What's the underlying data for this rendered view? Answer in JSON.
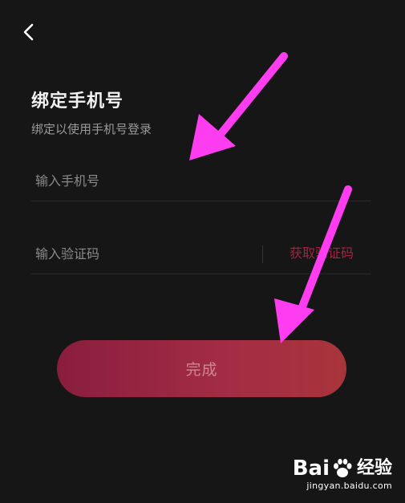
{
  "header": {
    "back_icon": "chevron-left-icon"
  },
  "page": {
    "title": "绑定手机号",
    "subtitle": "绑定以使用手机号登录"
  },
  "phone_field": {
    "placeholder": "输入手机号",
    "value": ""
  },
  "code_field": {
    "placeholder": "输入验证码",
    "value": "",
    "get_code_label": "获取验证码"
  },
  "submit": {
    "label": "完成"
  },
  "annotations": {
    "arrow_color": "#ff3df0"
  },
  "watermark": {
    "brand_left": "Bai",
    "brand_right": "经验",
    "url": "jingyan.baidu.com"
  },
  "colors": {
    "background": "#161616",
    "accent": "#a32240",
    "button_start": "#8a1d3e",
    "button_end": "#a8343b"
  }
}
